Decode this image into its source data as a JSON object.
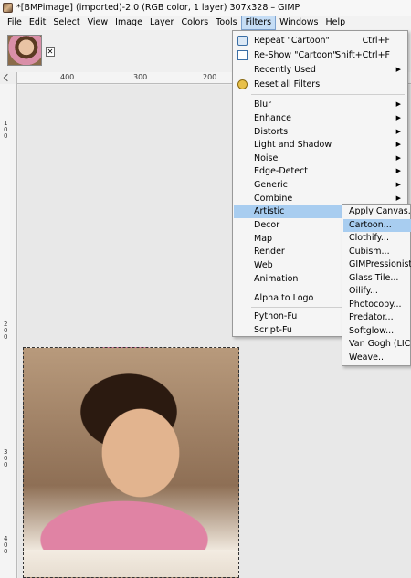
{
  "window": {
    "title": "*[BMPimage] (imported)-2.0 (RGB color, 1 layer) 307x328 – GIMP"
  },
  "menubar": {
    "items": [
      "File",
      "Edit",
      "Select",
      "View",
      "Image",
      "Layer",
      "Colors",
      "Tools",
      "Filters",
      "Windows",
      "Help"
    ],
    "active": "Filters"
  },
  "rulers": {
    "horizontal_ticks": [
      "400",
      "300",
      "200"
    ],
    "vertical_ticks": [
      "100",
      "200",
      "300",
      "400"
    ]
  },
  "filters_menu": {
    "repeat": {
      "label": "Repeat \"Cartoon\"",
      "shortcut": "Ctrl+F"
    },
    "reshow": {
      "label": "Re-Show \"Cartoon\"",
      "shortcut": "Shift+Ctrl+F"
    },
    "recently_used": "Recently Used",
    "reset_all": "Reset all Filters",
    "categories": [
      "Blur",
      "Enhance",
      "Distorts",
      "Light and Shadow",
      "Noise",
      "Edge-Detect",
      "Generic",
      "Combine",
      "Artistic",
      "Decor",
      "Map",
      "Render",
      "Web",
      "Animation"
    ],
    "alpha_to_logo": "Alpha to Logo",
    "python_fu": "Python-Fu",
    "script_fu": "Script-Fu",
    "highlighted": "Artistic"
  },
  "artistic_submenu": {
    "items": [
      "Apply Canvas...",
      "Cartoon...",
      "Clothify...",
      "Cubism...",
      "GIMPressionist...",
      "Glass Tile...",
      "Oilify...",
      "Photocopy...",
      "Predator...",
      "Softglow...",
      "Van Gogh (LIC)...",
      "Weave..."
    ],
    "highlighted": "Cartoon..."
  },
  "colors": {
    "highlight": "#a8cdf0",
    "menu_bg": "#f5f5f5"
  }
}
